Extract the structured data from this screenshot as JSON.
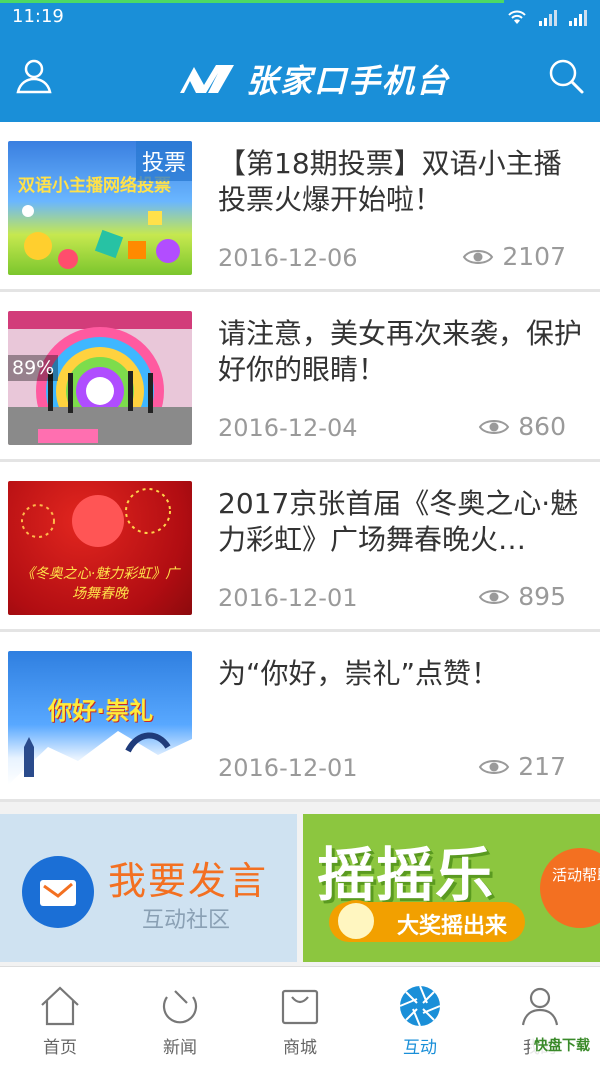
{
  "status_bar": {
    "time": "11:19"
  },
  "header": {
    "app_title": "张家口手机台",
    "accent": "#1a8fd8"
  },
  "feed": [
    {
      "title": "【第18期投票】双语小主播投票火爆开始啦！",
      "date": "2016-12-06",
      "views": "2107",
      "thumb_tag": "投票",
      "thumb_caption": "双语小主播网络投票"
    },
    {
      "title": "请注意，美女再次来袭，保护好你的眼睛！",
      "date": "2016-12-04",
      "views": "860",
      "thumb_overlay": "89%"
    },
    {
      "title": "2017京张首届《冬奥之心·魅力彩虹》广场舞春晚火…",
      "date": "2016-12-01",
      "views": "895",
      "thumb_caption": "《冬奥之心·魅力彩虹》广场舞春晚"
    },
    {
      "title": "为“你好，崇礼”点赞！",
      "date": "2016-12-01",
      "views": "217",
      "thumb_caption": "你好·崇礼"
    }
  ],
  "banners": {
    "left": {
      "headline": "我要发言",
      "sub": "互动社区"
    },
    "right": {
      "headline": "摇摇乐",
      "pill": "大奖摇出来",
      "help": "活动帮助"
    }
  },
  "tabs": [
    {
      "label": "首页",
      "icon": "home-icon"
    },
    {
      "label": "新闻",
      "icon": "news-icon"
    },
    {
      "label": "商城",
      "icon": "shop-bag-icon"
    },
    {
      "label": "互动",
      "icon": "aperture-icon",
      "active": true
    },
    {
      "label": "我的",
      "icon": "profile-icon"
    }
  ],
  "watermark": "快盘下载"
}
